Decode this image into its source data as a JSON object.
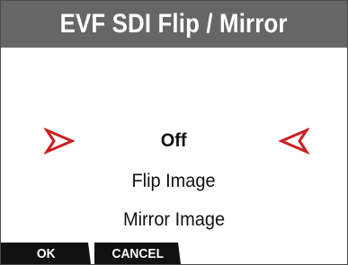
{
  "dialog": {
    "title": "EVF SDI Flip / Mirror"
  },
  "options": [
    {
      "label": "Off",
      "selected": true
    },
    {
      "label": "Flip Image",
      "selected": false
    },
    {
      "label": "Mirror Image",
      "selected": false
    }
  ],
  "softkeys": {
    "ok_label": "OK",
    "cancel_label": "CANCEL"
  },
  "colors": {
    "title_bg": "#666666",
    "arrow": "#cc1f1f",
    "softkey_bg": "#111111"
  },
  "icons": {
    "left_selector": "selection-arrow-right-icon",
    "right_selector": "selection-arrow-left-icon"
  }
}
